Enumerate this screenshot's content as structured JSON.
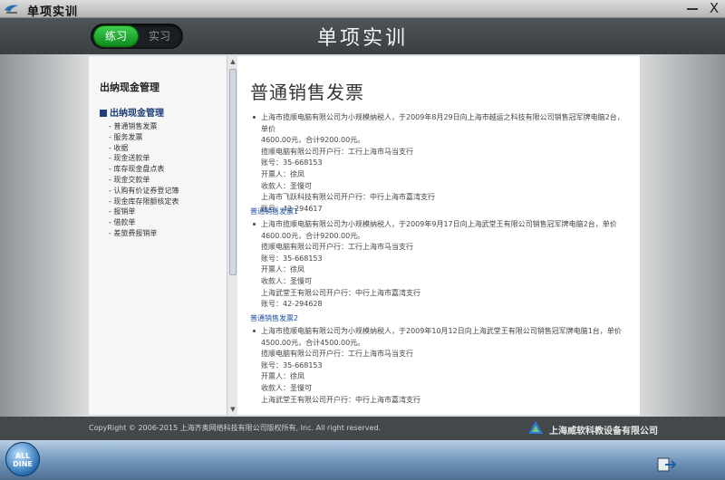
{
  "window": {
    "title": "单项实训"
  },
  "header": {
    "heading": "单项实训",
    "mode_toggle": {
      "active": "练习",
      "inactive": "实习"
    }
  },
  "sidebar": {
    "title": "出纳现金管理",
    "section": "出纳现金管理",
    "items": [
      "- 普通销售发票",
      "- 服务发票",
      "- 收据",
      "- 现金送款单",
      "- 库存现金盘点表",
      "- 现金交款单",
      "- 认购有价证券登记簿",
      "- 现金库存限额核定表",
      "- 报销单",
      "- 借款单",
      "- 差旅费报销单"
    ]
  },
  "content": {
    "page_title": "普通销售发票",
    "blocks": [
      {
        "link": "",
        "bullet": "上海市揽顺电脑有限公司为小规模纳税人，于2009年8月29日向上海市越运之科技有限公司销售冠军牌电脑2台，单价",
        "lines": [
          "4600.00元，合计9200.00元。",
          "揽顺电脑有限公司开户行：工行上海市马当支行",
          "账号：35-668153",
          "开票人：徐凤",
          "收款人：圣慢可",
          "上海市飞跃科技有限公司开户行：中行上海市嘉湾支行",
          "账号：42-294617"
        ]
      },
      {
        "link": "普通销售发票1",
        "bullet": "上海市揽顺电脑有限公司为小规模纳税人，于2009年9月17日向上海武堂王有限公司销售冠军牌电脑2台，单价",
        "lines": [
          "4600.00元，合计9200.00元。",
          "揽顺电脑有限公司开户行：工行上海市马当支行",
          "账号：35-668153",
          "开票人：徐凤",
          "收款人：圣慢可",
          "上海武堂王有限公司开户行：中行上海市嘉湾支行",
          "账号：42-294628"
        ]
      },
      {
        "link": "普通销售发票2",
        "bullet": "上海市揽顺电脑有限公司为小规模纳税人，于2009年10月12日向上海武堂王有限公司销售冠军牌电脑1台，单价",
        "lines": [
          "4500.00元，合计4500.00元。",
          "揽顺电脑有限公司开户行：工行上海市马当支行",
          "账号：35-668153",
          "开票人：徐凤",
          "收款人：圣慢可",
          "上海武堂王有限公司开户行：中行上海市嘉湾支行"
        ]
      }
    ]
  },
  "footer": {
    "copyright": "CopyRight © 2006-2015 上海齐奥网络科技有限公司版权所有, Inc. All right reserved.",
    "company": "上海威软科教设备有限公司"
  },
  "dock": {
    "start_label": "ALL DINE"
  },
  "icons": {
    "app": "app-logo-icon",
    "close": "close-icon",
    "minimize": "minimize-icon",
    "company_logo": "company-logo-icon",
    "exit": "exit-icon"
  },
  "colors": {
    "accent_green": "#1fae33",
    "link_blue": "#1c4ea3",
    "dock_blue": "#6f93b8"
  }
}
